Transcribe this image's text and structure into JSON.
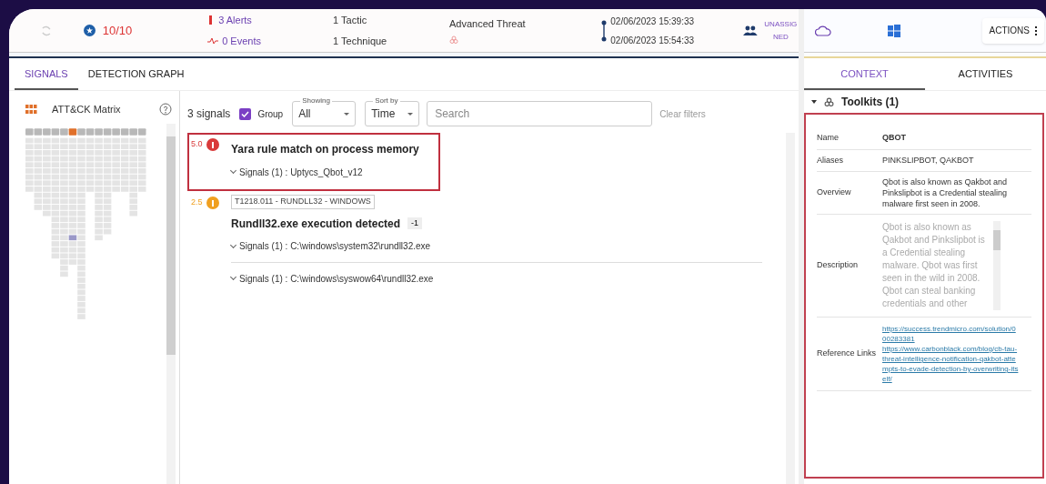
{
  "header": {
    "score": "10/10",
    "alerts": "3 Alerts",
    "events": "0 Events",
    "tactic": "1 Tactic",
    "technique": "1 Technique",
    "threat": "Advanced Threat",
    "time_start": "02/06/2023 15:39:33",
    "time_end": "02/06/2023 15:54:33",
    "assignee": "UNASSIGNED",
    "actions": "ACTIONS"
  },
  "tabs": [
    {
      "label": "SIGNALS",
      "selected": true
    },
    {
      "label": "DETECTION GRAPH",
      "selected": false
    }
  ],
  "matrix": {
    "title": "ATT&CK Matrix"
  },
  "toolbar": {
    "count": "3 signals",
    "group": {
      "label": "Group",
      "checked": true
    },
    "showing": {
      "label": "Showing",
      "value": "All"
    },
    "sort": {
      "label": "Sort by",
      "value": "Time"
    },
    "search": {
      "placeholder": "Search"
    },
    "clear": "Clear filters"
  },
  "signals": [
    {
      "score": "5.0",
      "color": "#d93a3a",
      "title": "Yara rule match on process memory",
      "selected": true,
      "groups": [
        "Signals (1) : Uptycs_Qbot_v12"
      ]
    },
    {
      "score": "2.5",
      "color": "#f0a020",
      "tag": "T1218.011 - RUNDLL32 - WINDOWS",
      "title": "Rundll32.exe execution detected",
      "badge": "-1",
      "selected": false,
      "groups": [
        "Signals (1) : C:\\windows\\system32\\rundll32.exe",
        "Signals (1) : C:\\windows\\syswow64\\rundll32.exe"
      ]
    }
  ],
  "right_tabs": [
    {
      "label": "CONTEXT",
      "selected": true
    },
    {
      "label": "ACTIVITIES",
      "selected": false
    }
  ],
  "toolkits": {
    "title": "Toolkits (1)",
    "expanded": true,
    "rows": [
      {
        "kind": "bold",
        "label": "Name",
        "value": "QBOT"
      },
      {
        "kind": "text",
        "label": "Aliases",
        "value": "PINKSLIPBOT, QAKBOT"
      },
      {
        "kind": "text",
        "label": "Overview",
        "value": "Qbot is also known as Qakbot and Pinkslipbot is a Credential stealing malware first seen in 2008."
      },
      {
        "kind": "scroll",
        "label": "Description",
        "value": "Qbot is also known as Qakbot and Pinkslipbot is a Credential stealing malware. Qbot was first seen in the wild in 2008. Qbot can steal banking credentials and other"
      },
      {
        "kind": "links",
        "label": "Reference Links",
        "links": [
          "https://success.trendmicro.com/solution/000283381",
          "https://www.carbonblack.com/blog/cb-tau-threat-intelligence-notification-qakbot-attempts-to-evade-detection-by-overwriting-itself/"
        ]
      }
    ]
  }
}
